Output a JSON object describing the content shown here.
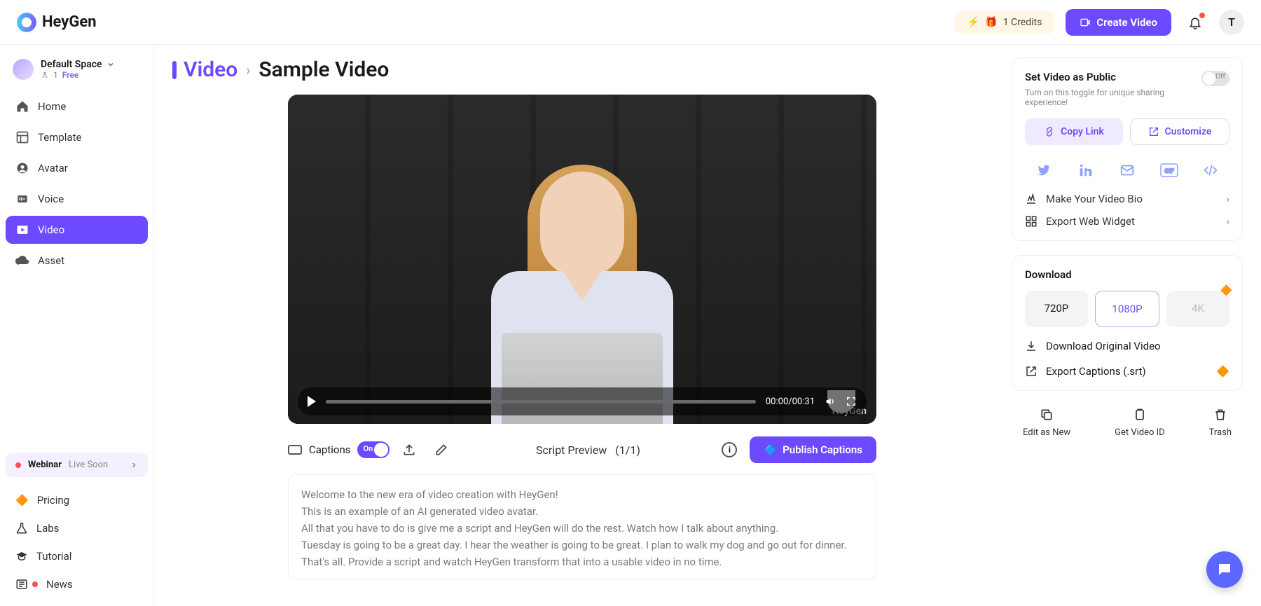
{
  "brand": "HeyGen",
  "header": {
    "credits_label": "1 Credits",
    "create_video": "Create Video",
    "avatar_letter": "T"
  },
  "workspace": {
    "name": "Default Space",
    "members": "1",
    "plan": "Free"
  },
  "sidebar": {
    "items": [
      {
        "label": "Home"
      },
      {
        "label": "Template"
      },
      {
        "label": "Avatar"
      },
      {
        "label": "Voice"
      },
      {
        "label": "Video"
      },
      {
        "label": "Asset"
      }
    ],
    "webinar": {
      "title": "Webinar",
      "status": "Live Soon"
    },
    "bottom": [
      {
        "label": "Pricing"
      },
      {
        "label": "Labs"
      },
      {
        "label": "Tutorial"
      },
      {
        "label": "News"
      }
    ]
  },
  "breadcrumb": {
    "section": "Video",
    "title": "Sample Video"
  },
  "player": {
    "time_current": "00:00",
    "time_total": "00:31",
    "watermark": "HeyGen"
  },
  "captions": {
    "label": "Captions",
    "toggle": "On",
    "script_preview": "Script Preview",
    "script_count": "(1/1)",
    "publish": "Publish Captions"
  },
  "script_text": "Welcome to the new era of video creation with HeyGen!\nThis is an example of an AI generated video avatar.\nAll that you have to do is give me a script and HeyGen will do the rest. Watch how I talk about anything.\nTuesday is going to be a great day. I hear the weather is going to be great. I plan to walk my dog and go out for dinner.\nThat's all. Provide a script and watch HeyGen transform that into a usable video in no time.",
  "share_card": {
    "title": "Set Video as Public",
    "sub": "Turn on this toggle for unique sharing experience!",
    "toggle": "Off",
    "copy": "Copy Link",
    "customize": "Customize",
    "bio": "Make Your Video Bio",
    "widget": "Export Web Widget"
  },
  "download": {
    "title": "Download",
    "res": [
      "720P",
      "1080P",
      "4K"
    ],
    "original": "Download Original Video",
    "captions": "Export Captions (.srt)"
  },
  "actions": {
    "edit": "Edit as New",
    "get_id": "Get Video ID",
    "trash": "Trash"
  }
}
